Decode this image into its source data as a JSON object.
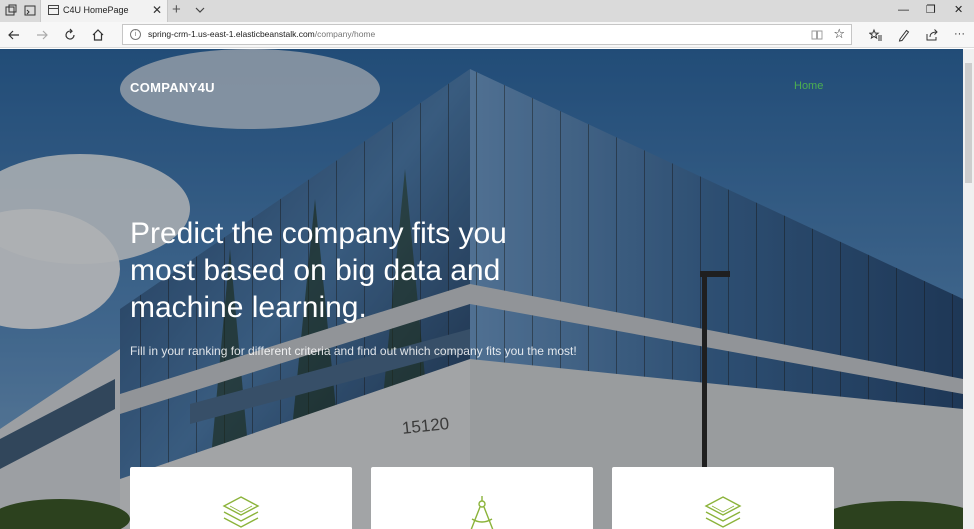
{
  "browser": {
    "tab": {
      "title": "C4U HomePage",
      "close": "✕"
    },
    "new_tab": "+",
    "window_controls": {
      "minimize": "—",
      "restore": "❐",
      "close": "✕"
    },
    "address": {
      "host": "spring-crm-1.us-east-1.elasticbeanstalk.com",
      "path": "/company/home"
    }
  },
  "header": {
    "brand": "COMPANY4U",
    "nav_home": "Home",
    "nav_home_color": "#4caf50"
  },
  "hero": {
    "headline": "Predict the company fits you most based on big data and machine learning.",
    "subheadline": "Fill in your ranking for different criteria and find out which company fits you the most!",
    "building_number": "15120"
  },
  "feature_cards": [
    {
      "icon": "layers-icon"
    },
    {
      "icon": "compass-icon"
    },
    {
      "icon": "layers-icon"
    }
  ],
  "colors": {
    "accent": "#8bb33a",
    "nav_active": "#4caf50"
  }
}
